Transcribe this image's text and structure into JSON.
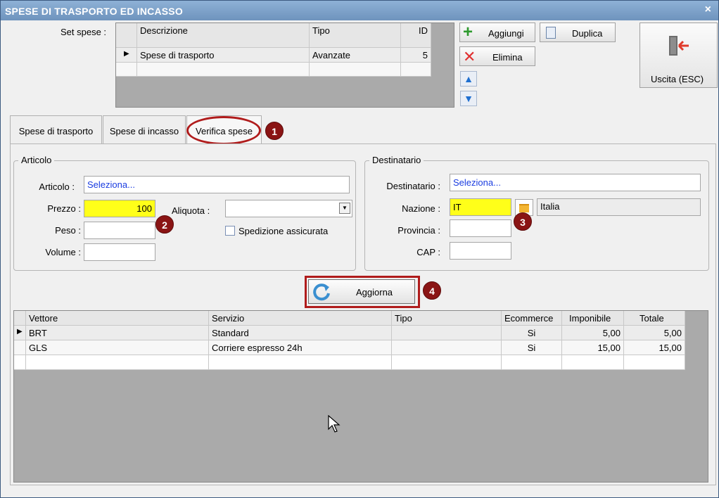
{
  "window": {
    "title": "SPESE DI TRASPORTO ED INCASSO",
    "close_glyph": "×"
  },
  "set_spese": {
    "label": "Set spese :",
    "columns": [
      "Descrizione",
      "Tipo",
      "ID"
    ],
    "rows": [
      {
        "descrizione": "Spese di trasporto",
        "tipo": "Avanzate",
        "id": "5"
      }
    ],
    "row_indicator": "▶"
  },
  "toolbar": {
    "aggiungi": "Aggiungi",
    "duplica": "Duplica",
    "elimina": "Elimina",
    "uscita": "Uscita (ESC)"
  },
  "tabs": [
    "Spese di trasporto",
    "Spese di incasso",
    "Verifica spese"
  ],
  "articolo": {
    "legend": "Articolo",
    "articolo_label": "Articolo :",
    "articolo_value": "Seleziona...",
    "prezzo_label": "Prezzo :",
    "prezzo_value": "100",
    "aliquota_label": "Aliquota :",
    "aliquota_value": "",
    "peso_label": "Peso :",
    "peso_value": "",
    "volume_label": "Volume :",
    "volume_value": "",
    "spedizione_label": "Spedizione assicurata"
  },
  "destinatario": {
    "legend": "Destinatario",
    "destinatario_label": "Destinatario :",
    "destinatario_value": "Seleziona...",
    "nazione_label": "Nazione :",
    "nazione_value": "IT",
    "nazione_name": "Italia",
    "provincia_label": "Provincia :",
    "provincia_value": "",
    "cap_label": "CAP :",
    "cap_value": ""
  },
  "aggiorna": "Aggiorna",
  "badges": [
    "1",
    "2",
    "3",
    "4"
  ],
  "results": {
    "columns": [
      "Vettore",
      "Servizio",
      "Tipo",
      "Ecommerce",
      "Imponibile",
      "Totale"
    ],
    "rows": [
      {
        "vettore": "BRT",
        "servizio": "Standard",
        "tipo": "",
        "ecommerce": "Si",
        "imponibile": "5,00",
        "totale": "5,00"
      },
      {
        "vettore": "GLS",
        "servizio": "Corriere espresso 24h",
        "tipo": "",
        "ecommerce": "Si",
        "imponibile": "15,00",
        "totale": "15,00"
      }
    ]
  },
  "colors": {
    "title_bar": "#7a9ec8",
    "highlight_yellow": "#ffff19",
    "annotation_red": "#b01c1c",
    "badge": "#8a1414"
  }
}
